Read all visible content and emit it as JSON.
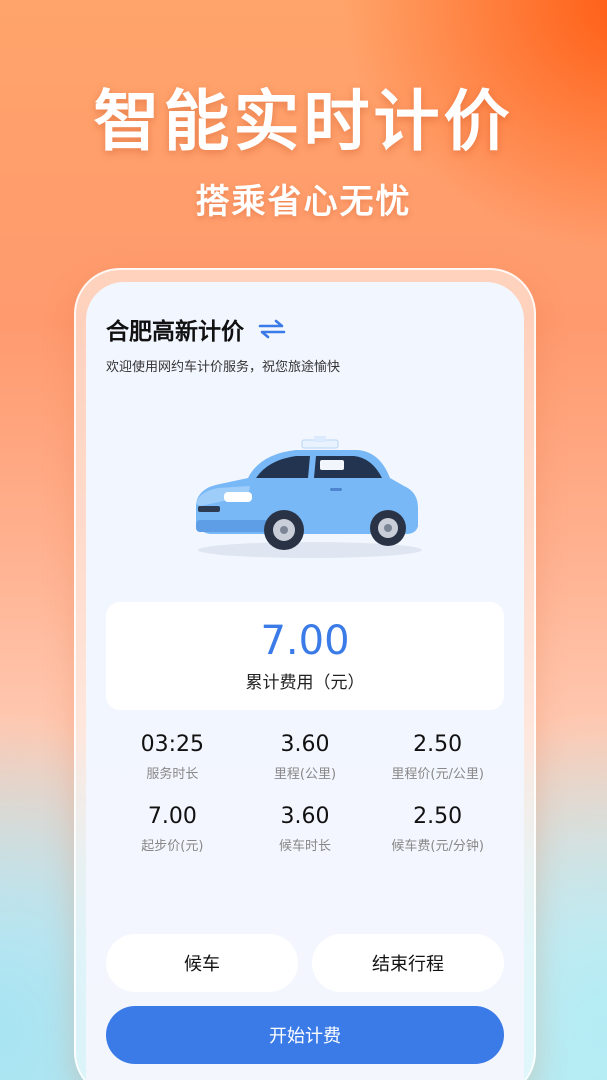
{
  "banner": {
    "headline": "智能实时计价",
    "subhead": "搭乘省心无忧"
  },
  "app": {
    "city": "合肥高新计价",
    "swap_icon": "swap-arrows-icon",
    "welcome": "欢迎使用网约车计价服务，祝您旅途愉快",
    "accent_color": "#3a7be8"
  },
  "fare": {
    "value": "7.00",
    "label": "累计费用（元）"
  },
  "stats": [
    {
      "value": "03:25",
      "label": "服务时长"
    },
    {
      "value": "3.60",
      "label": "里程(公里)"
    },
    {
      "value": "2.50",
      "label": "里程价(元/公里)"
    },
    {
      "value": "7.00",
      "label": "起步价(元)"
    },
    {
      "value": "3.60",
      "label": "候车时长"
    },
    {
      "value": "2.50",
      "label": "候车费(元/分钟)"
    }
  ],
  "buttons": {
    "wait": "候车",
    "end_trip": "结束行程",
    "start_billing": "开始计费"
  }
}
